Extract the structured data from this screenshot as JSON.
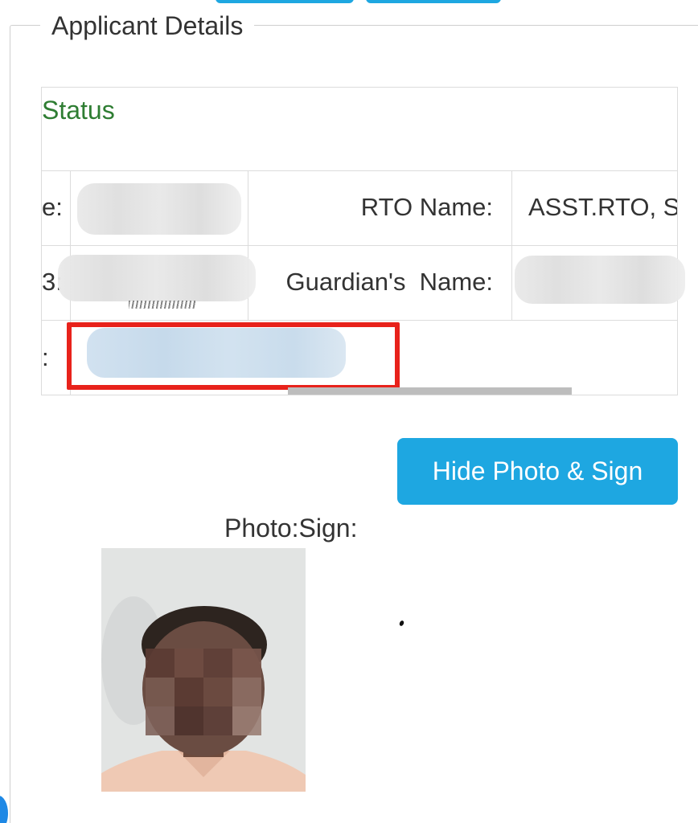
{
  "top_buttons": [
    {
      "name": "top-action-button-1"
    },
    {
      "name": "top-action-button-2"
    }
  ],
  "section": {
    "legend": "Applicant Details"
  },
  "table": {
    "status_title": "Status",
    "rows": [
      {
        "left_label_fragment": "e:",
        "label": "RTO Name:",
        "value": "ASST.RTO, S"
      },
      {
        "left_label_fragment": "3:",
        "label": "Guardian's  Name:",
        "value": ""
      },
      {
        "left_label_fragment": ":",
        "label": "",
        "value": ""
      }
    ]
  },
  "buttons": {
    "hide_photo_sign": "Hide Photo & Sign"
  },
  "photo_section": {
    "label": "Photo:Sign:"
  },
  "colors": {
    "accent": "#1ea7e1",
    "status_green": "#2e7d32",
    "highlight_red": "#e8221b",
    "border": "#dcdcdc"
  }
}
